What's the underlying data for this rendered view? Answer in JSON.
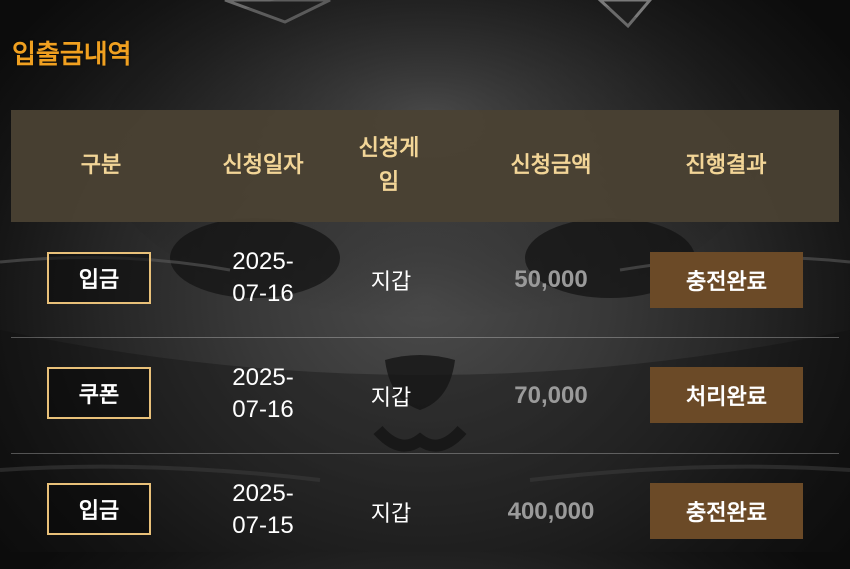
{
  "page": {
    "title": "입출금내역"
  },
  "table": {
    "headers": {
      "type": "구분",
      "date": "신청일자",
      "game_line1": "신청게",
      "game_line2": "임",
      "amount": "신청금액",
      "result": "진행결과"
    },
    "rows": [
      {
        "type": "입금",
        "date_line1": "2025-",
        "date_line2": "07-16",
        "game": "지갑",
        "amount": "50,000",
        "status": "충전완료"
      },
      {
        "type": "쿠폰",
        "date_line1": "2025-",
        "date_line2": "07-16",
        "game": "지갑",
        "amount": "70,000",
        "status": "처리완료"
      },
      {
        "type": "입금",
        "date_line1": "2025-",
        "date_line2": "07-15",
        "game": "지갑",
        "amount": "400,000",
        "status": "충전완료"
      }
    ]
  },
  "colors": {
    "title": "#f0a020",
    "header_bg": "#4a4233",
    "header_text": "#f2d597",
    "badge_border": "#e8c079",
    "status_bg": "#6b4a27",
    "amount_text": "#9a9a9a"
  }
}
